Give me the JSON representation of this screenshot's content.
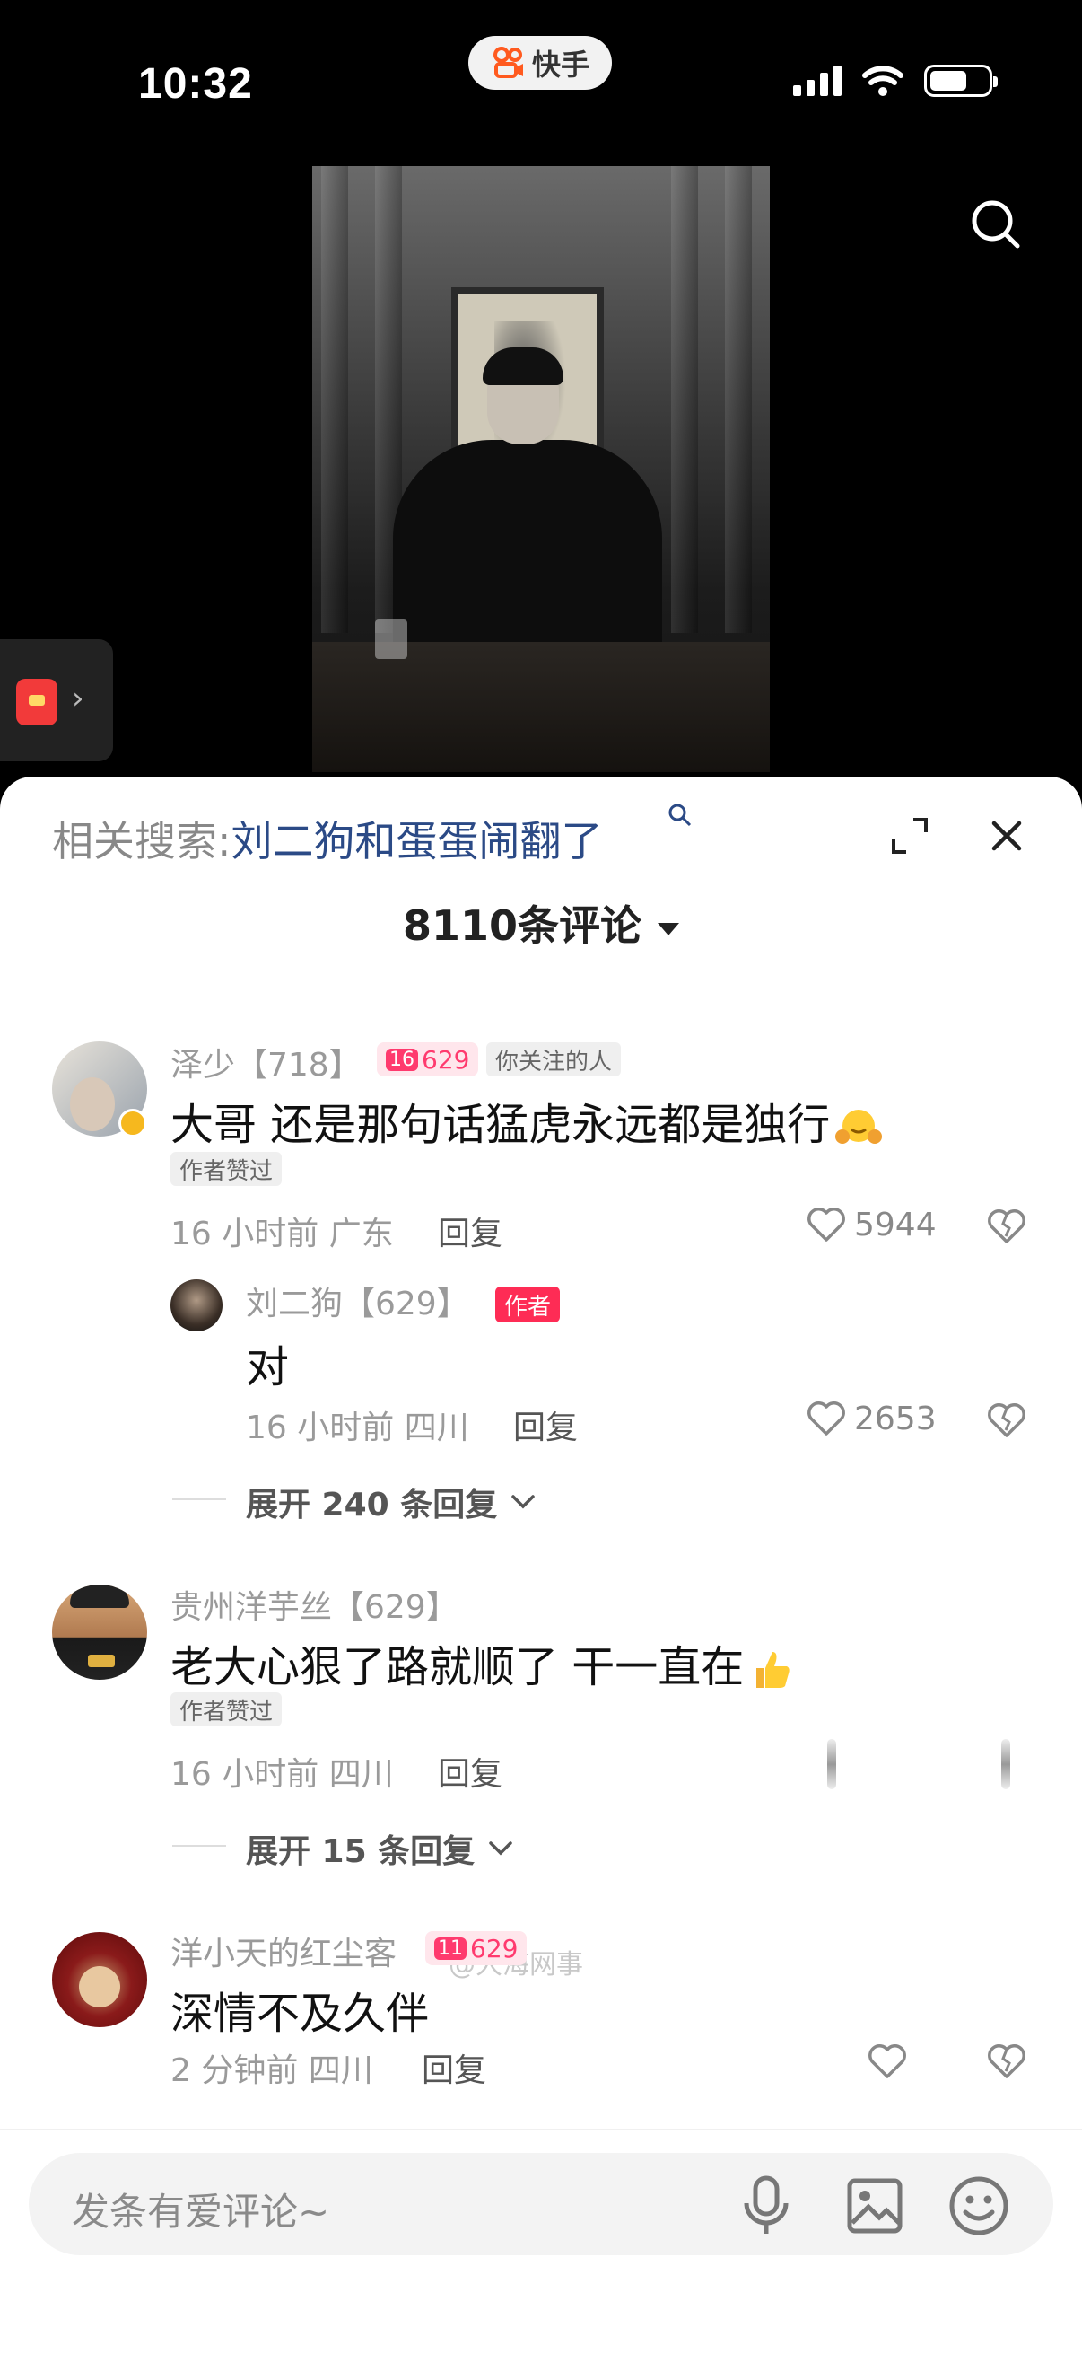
{
  "status_bar": {
    "time": "10:32",
    "app_name": "快手"
  },
  "sheet": {
    "related_label": "相关搜索:",
    "related_keyword": "刘二狗和蛋蛋闹翻了",
    "comment_count_title": "8110条评论"
  },
  "comments": [
    {
      "username": "泽少【718】",
      "badge": "629",
      "badge_num": "16",
      "follow_tag": "你关注的人",
      "text": "大哥 还是那句话猛虎永远都是独行",
      "author_liked": "作者赞过",
      "time": "16 小时前",
      "location": "广东",
      "reply": "回复",
      "likes": "5944"
    },
    {
      "username": "刘二狗【629】",
      "author_tag": "作者",
      "text": "对",
      "time": "16 小时前",
      "location": "四川",
      "reply": "回复",
      "likes": "2653"
    },
    {
      "expand_text": "展开 240 条回复"
    },
    {
      "username": "贵州洋芋丝【629】",
      "text": "老大心狠了路就顺了 干一直在",
      "author_liked": "作者赞过",
      "time": "16 小时前",
      "location": "四川",
      "reply": "回复",
      "expand_text": "展开 15 条回复"
    },
    {
      "username": "洋小天的红尘客",
      "badge": "629",
      "badge_num": "11",
      "text": "深情不及久伴",
      "time": "2 分钟前",
      "location": "四川",
      "reply": "回复"
    }
  ],
  "watermark": "@大海网事",
  "input": {
    "placeholder": "发条有爱评论~"
  },
  "colors": {
    "accent_pink": "#fe2c55",
    "keyword_blue": "#2b4a86"
  }
}
